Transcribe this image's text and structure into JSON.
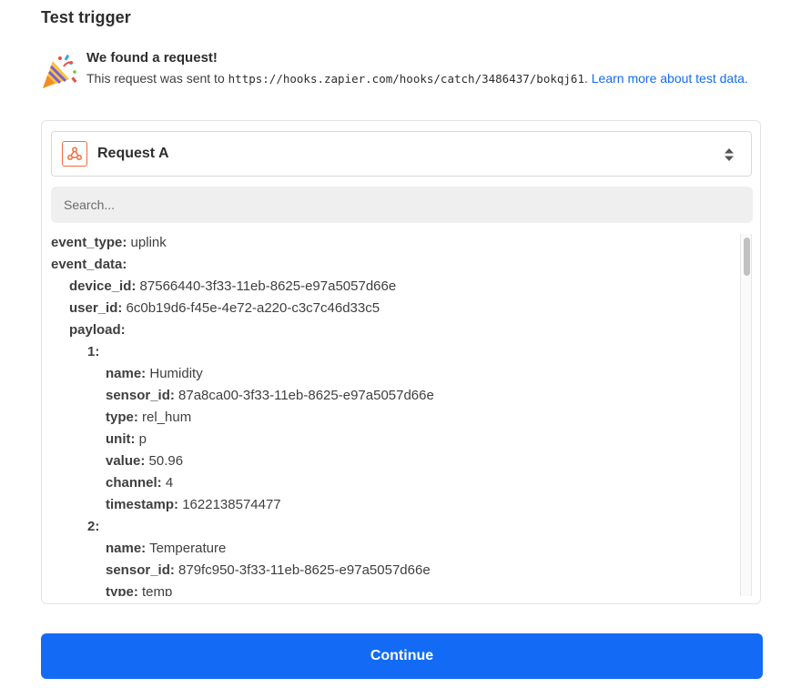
{
  "header": {
    "title": "Test trigger"
  },
  "found": {
    "heading": "We found a request!",
    "body_prefix": "This request was sent to",
    "url": "https://hooks.zapier.com/hooks/catch/3486437/bokqj61",
    "body_suffix": ".",
    "link_text": "Learn more about test data."
  },
  "request_select": {
    "value": "Request A",
    "icon": "webhook-icon"
  },
  "search": {
    "placeholder": "Search..."
  },
  "data_rows": [
    {
      "key": "event_type:",
      "value": "uplink",
      "indent": 0
    },
    {
      "key": "event_data:",
      "value": "",
      "indent": 0
    },
    {
      "key": "device_id:",
      "value": "87566440-3f33-11eb-8625-e97a5057d66e",
      "indent": 1
    },
    {
      "key": "user_id:",
      "value": "6c0b19d6-f45e-4e72-a220-c3c7c46d33c5",
      "indent": 1
    },
    {
      "key": "payload:",
      "value": "",
      "indent": 1
    },
    {
      "key": "1:",
      "value": "",
      "indent": 2
    },
    {
      "key": "name:",
      "value": "Humidity",
      "indent": 3
    },
    {
      "key": "sensor_id:",
      "value": "87a8ca00-3f33-11eb-8625-e97a5057d66e",
      "indent": 3
    },
    {
      "key": "type:",
      "value": "rel_hum",
      "indent": 3
    },
    {
      "key": "unit:",
      "value": "p",
      "indent": 3
    },
    {
      "key": "value:",
      "value": "50.96",
      "indent": 3
    },
    {
      "key": "channel:",
      "value": "4",
      "indent": 3
    },
    {
      "key": "timestamp:",
      "value": "1622138574477",
      "indent": 3
    },
    {
      "key": "2:",
      "value": "",
      "indent": 2
    },
    {
      "key": "name:",
      "value": "Temperature",
      "indent": 3
    },
    {
      "key": "sensor_id:",
      "value": "879fc950-3f33-11eb-8625-e97a5057d66e",
      "indent": 3
    },
    {
      "key": "type:",
      "value": "temp",
      "indent": 3
    }
  ],
  "actions": {
    "continue_label": "Continue"
  },
  "colors": {
    "primary": "#136bf5",
    "link": "#136bf5",
    "app_icon_border": "#f26b3a"
  }
}
